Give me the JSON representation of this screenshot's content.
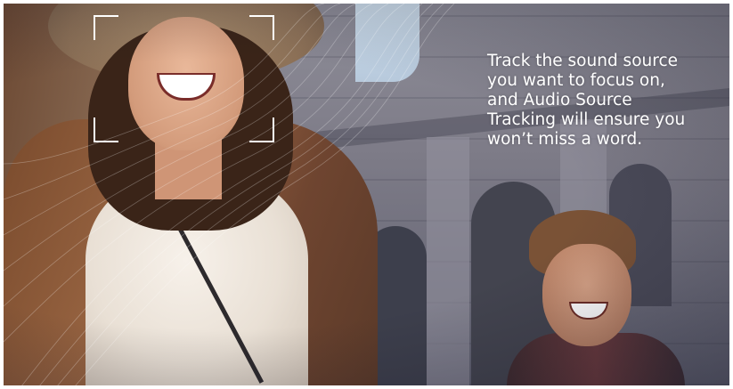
{
  "photo": {
    "subject": "woman-and-man-at-colosseum"
  },
  "focus_frame": {
    "color": "#ffffff"
  },
  "caption": {
    "lines": [
      "Track the sound source",
      "you want to focus on,",
      "and Audio Source",
      "Tracking will ensure you",
      "won’t miss a word."
    ],
    "color": "#ffffff"
  }
}
